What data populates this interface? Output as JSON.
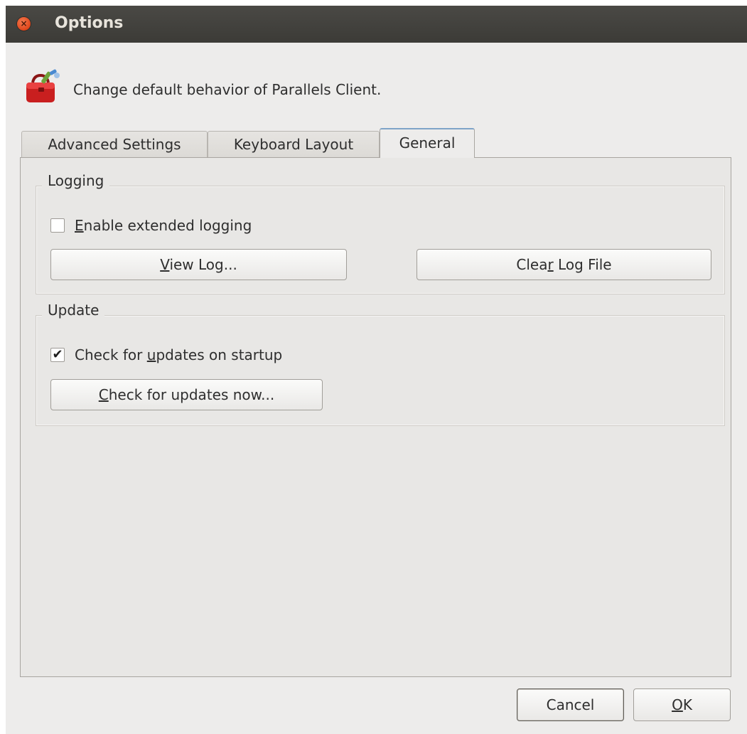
{
  "window": {
    "title": "Options",
    "close_glyph": "×"
  },
  "header": {
    "icon": "toolbox-icon",
    "description": "Change default behavior of Parallels Client."
  },
  "tabs": [
    {
      "label": "Advanced Settings",
      "active": false
    },
    {
      "label": "Keyboard Layout",
      "active": false
    },
    {
      "label": "General",
      "active": true
    }
  ],
  "logging": {
    "title": "Logging",
    "extended_logging": {
      "label_mnemonic": "E",
      "label_rest": "nable extended logging",
      "checked": false
    },
    "view_log": {
      "label_mnemonic": "V",
      "label_rest": "iew Log..."
    },
    "clear_log": {
      "label_pre": "Clea",
      "label_mnemonic": "r",
      "label_rest": " Log File"
    }
  },
  "update": {
    "title": "Update",
    "check_on_startup": {
      "label_pre": "Check for ",
      "label_mnemonic": "u",
      "label_rest": "pdates on startup",
      "checked": true,
      "check_glyph": "✔"
    },
    "check_now": {
      "label_mnemonic": "C",
      "label_rest": "heck for updates now..."
    }
  },
  "footer": {
    "cancel_label": "Cancel",
    "ok_mnemonic": "O",
    "ok_rest": "K"
  },
  "colors": {
    "titlebar": "#3c3b37",
    "window_bg": "#edeceb",
    "close_button": "#e0461b",
    "active_tab_accent": "#7fa4c8",
    "toolbox_red": "#d42b2b"
  }
}
